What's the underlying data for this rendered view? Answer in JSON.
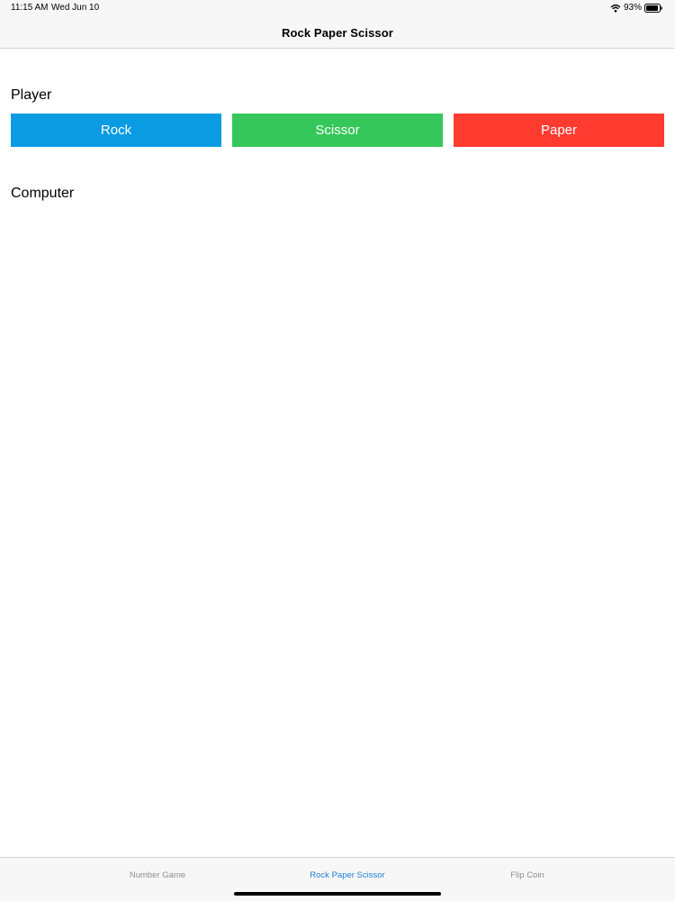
{
  "status_bar": {
    "time": "11:15 AM",
    "date": "Wed Jun 10",
    "battery": "93%",
    "battery_level": 0.93
  },
  "nav": {
    "title": "Rock Paper Scissor"
  },
  "player": {
    "label": "Player",
    "choices": [
      {
        "label": "Rock",
        "color": "#0a9be3"
      },
      {
        "label": "Scissor",
        "color": "#35c759"
      },
      {
        "label": "Paper",
        "color": "#ff3b30"
      }
    ]
  },
  "computer": {
    "label": "Computer"
  },
  "tab_bar": {
    "active_color": "#1e7fd6",
    "items": [
      {
        "label": "Number Game",
        "active": false
      },
      {
        "label": "Rock Paper Scissor",
        "active": true
      },
      {
        "label": "Flip Coin",
        "active": false
      }
    ]
  },
  "icons": {
    "wifi": "wifi-icon",
    "battery": "battery-icon"
  }
}
